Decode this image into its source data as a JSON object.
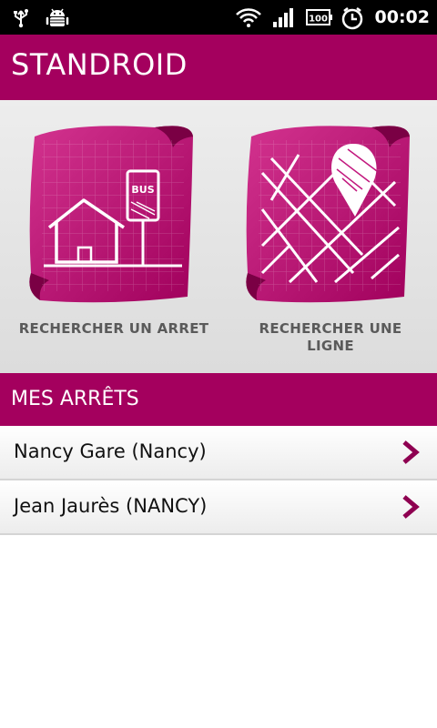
{
  "status_bar": {
    "time": "00:02",
    "battery_level": "100",
    "icons": [
      "usb-icon",
      "android-debug-icon",
      "wifi-icon",
      "signal-icon",
      "battery-icon",
      "alarm-icon"
    ]
  },
  "header": {
    "title": "STANDROID"
  },
  "tiles": [
    {
      "label": "RECHERCHER UN ARRET",
      "icon": "bus-stop-icon",
      "sign_text": "BUS"
    },
    {
      "label": "RECHERCHER UNE LIGNE",
      "icon": "map-pin-icon"
    }
  ],
  "section": {
    "title": "MES ARRÊTS"
  },
  "stops": [
    {
      "label": "Nancy Gare (Nancy)"
    },
    {
      "label": "Jean Jaurès (NANCY)"
    }
  ],
  "colors": {
    "accent": "#a4005e",
    "tile": "#c2187e",
    "text": "#111111",
    "tile_label": "#5a5a5a"
  }
}
